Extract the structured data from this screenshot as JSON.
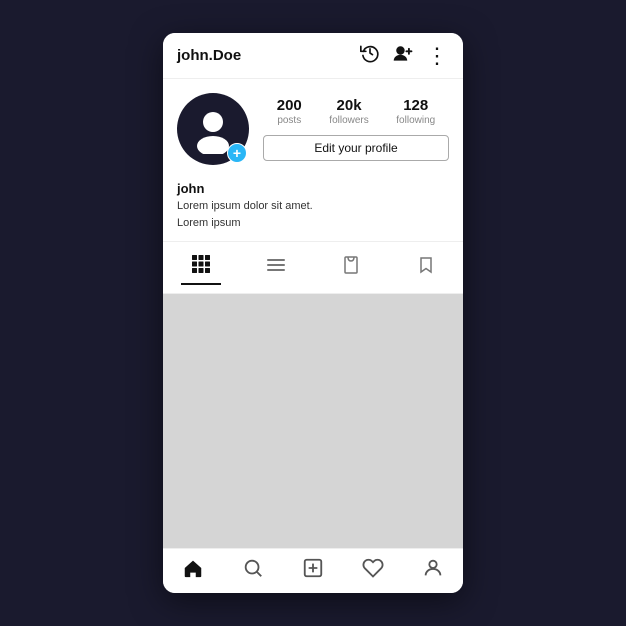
{
  "topBar": {
    "username": "john.Doe",
    "historyIcon": "🕐",
    "addPersonIcon": "👤+",
    "moreIcon": "⋮"
  },
  "profile": {
    "stats": {
      "posts": {
        "count": "200",
        "label": "posts"
      },
      "followers": {
        "count": "20k",
        "label": "followers"
      },
      "following": {
        "count": "128",
        "label": "following"
      }
    },
    "editButton": "Edit your profile",
    "addBadge": "+"
  },
  "bio": {
    "name": "john",
    "line1": "Lorem ipsum dolor sit amet.",
    "line2": "Lorem ipsum"
  },
  "tabs": {
    "grid": "⊞",
    "list": "≡",
    "tag": "⬜",
    "bookmark": "🔖"
  },
  "bottomNav": {
    "home": "⌂",
    "search": "🔍",
    "add": "➕",
    "heart": "♥",
    "profile": "👤"
  }
}
